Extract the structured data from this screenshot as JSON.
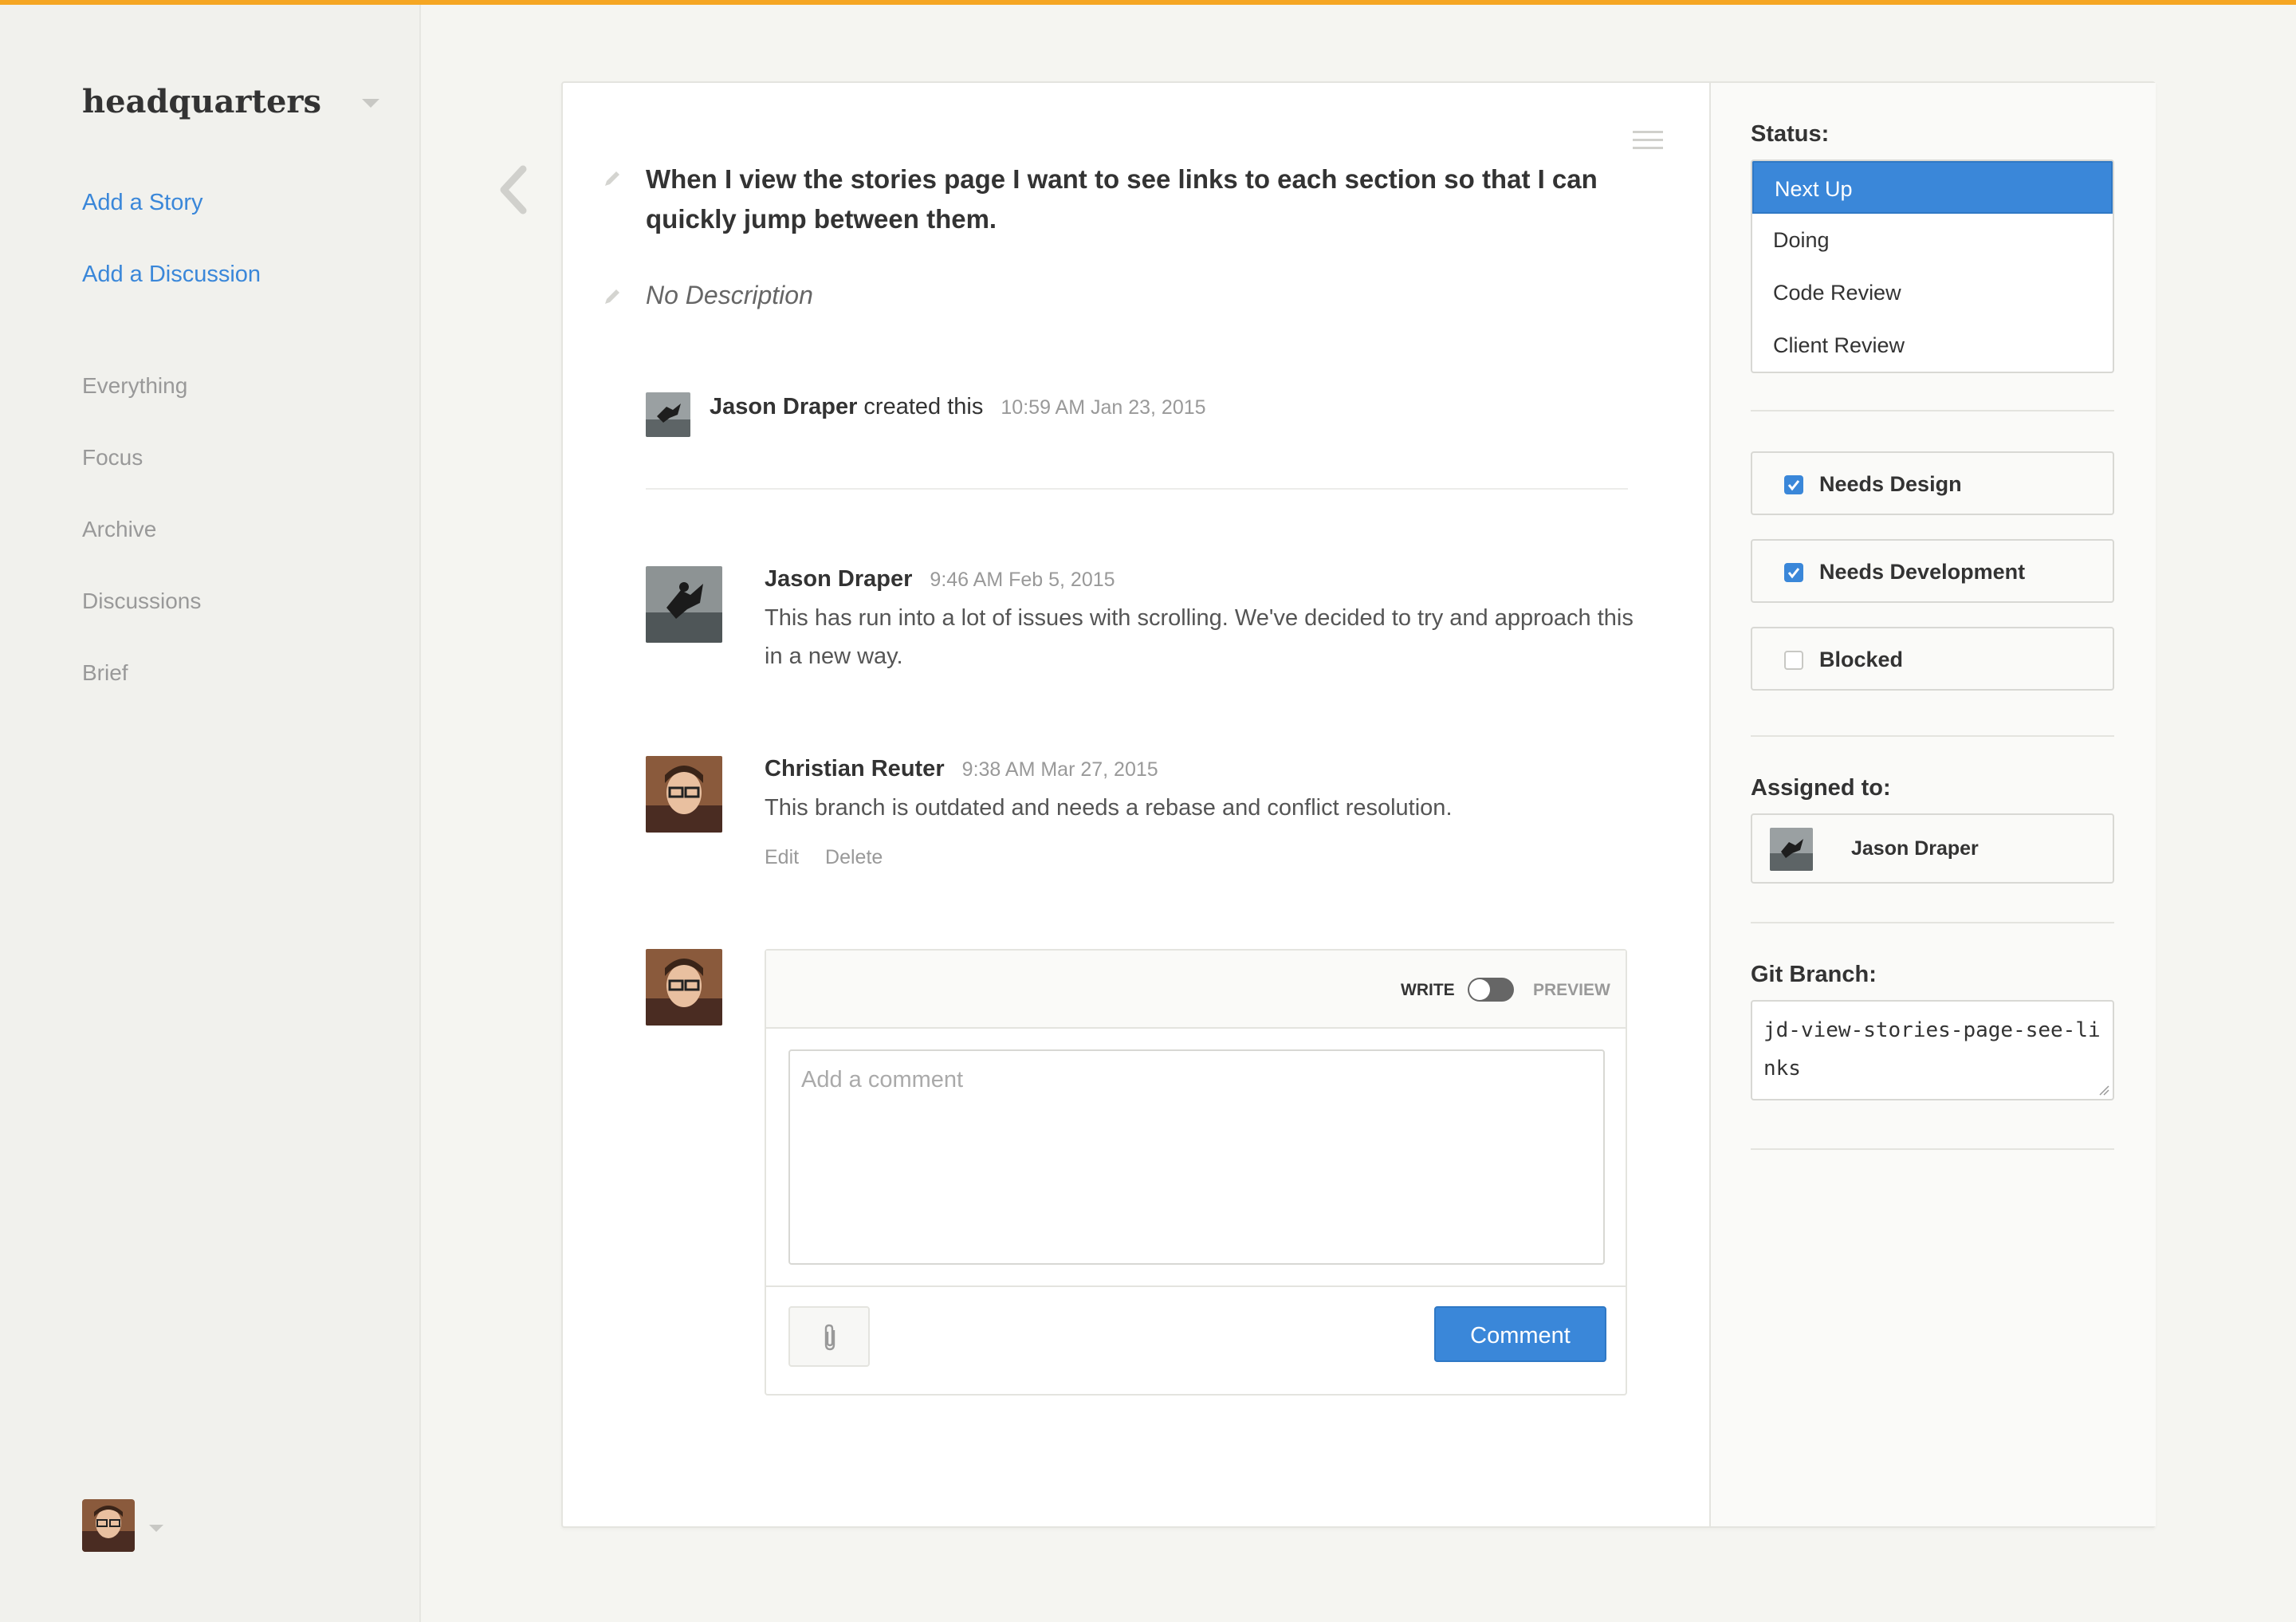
{
  "workspace": {
    "name": "headquarters"
  },
  "sidebar": {
    "actions": [
      {
        "label": "Add a Story"
      },
      {
        "label": "Add a Discussion"
      }
    ],
    "nav": [
      {
        "label": "Everything"
      },
      {
        "label": "Focus"
      },
      {
        "label": "Archive"
      },
      {
        "label": "Discussions"
      },
      {
        "label": "Brief"
      }
    ]
  },
  "story": {
    "title": "When I view the stories page I want to see links to each section so that I can quickly jump between them.",
    "description": "No Description",
    "created": {
      "author": "Jason Draper",
      "verb": "created this",
      "timestamp": "10:59 AM Jan 23, 2015"
    }
  },
  "comments": [
    {
      "author": "Jason Draper",
      "timestamp": "9:46 AM Feb 5, 2015",
      "body": "This has run into a lot of issues with scrolling. We've decided to try and approach this in a new way."
    },
    {
      "author": "Christian Reuter",
      "timestamp": "9:38 AM Mar 27, 2015",
      "body": "This branch is outdated and needs a rebase and conflict resolution.",
      "actions": {
        "edit": "Edit",
        "delete": "Delete"
      }
    }
  ],
  "composer": {
    "write_label": "WRITE",
    "preview_label": "PREVIEW",
    "placeholder": "Add a comment",
    "submit_label": "Comment",
    "preview_on": false
  },
  "panel": {
    "status": {
      "label": "Status:",
      "options": [
        "Next Up",
        "Doing",
        "Code Review",
        "Client Review"
      ],
      "selected": "Next Up"
    },
    "flags": [
      {
        "label": "Needs Design",
        "checked": true
      },
      {
        "label": "Needs Development",
        "checked": true
      },
      {
        "label": "Blocked",
        "checked": false
      }
    ],
    "assigned": {
      "label": "Assigned to:",
      "name": "Jason Draper"
    },
    "git": {
      "label": "Git Branch:",
      "branch": "jd-view-stories-page-see-links"
    }
  },
  "colors": {
    "accent": "#f5a623",
    "primary": "#3a87d9",
    "background": "#f5f5f1"
  }
}
